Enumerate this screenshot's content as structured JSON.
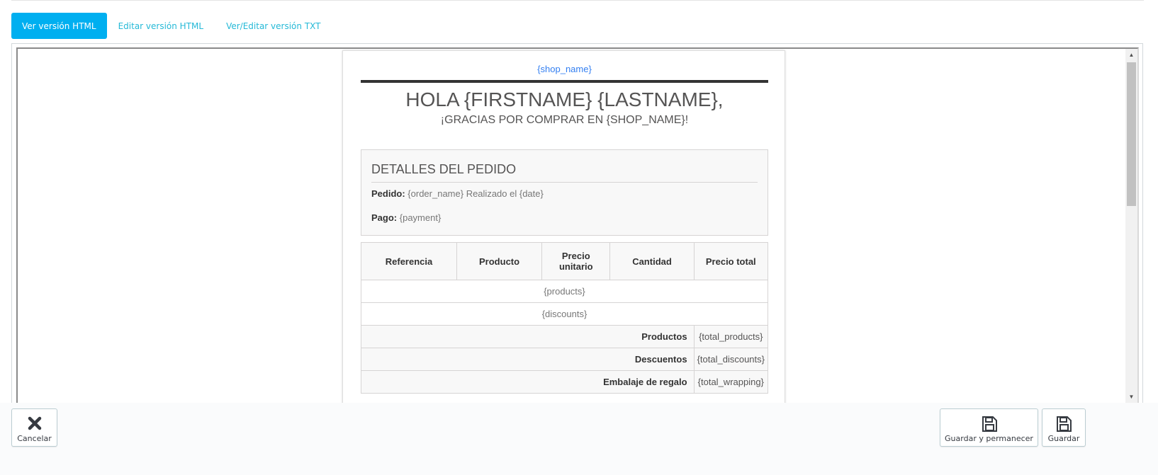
{
  "tabs": [
    {
      "label": "Ver versión HTML",
      "active": true
    },
    {
      "label": "Editar versión HTML",
      "active": false
    },
    {
      "label": "Ver/Editar versión TXT",
      "active": false
    }
  ],
  "email": {
    "shop_link": "{shop_name}",
    "greeting": "HOLA {FIRSTNAME} {LASTNAME},",
    "thanks": "¡GRACIAS POR COMPRAR EN {SHOP_NAME}!",
    "details": {
      "title": "DETALLES DEL PEDIDO",
      "order_label": "Pedido:",
      "order_value": "{order_name} Realizado el {date}",
      "payment_label": "Pago:",
      "payment_value": "{payment}"
    },
    "table": {
      "headers": [
        "Referencia",
        "Producto",
        "Precio unitario",
        "Cantidad",
        "Precio total"
      ],
      "products": "{products}",
      "discounts": "{discounts}",
      "totals": [
        {
          "label": "Productos",
          "value": "{total_products}"
        },
        {
          "label": "Descuentos",
          "value": "{total_discounts}"
        },
        {
          "label": "Embalaje de regalo",
          "value": "{total_wrapping}"
        }
      ]
    }
  },
  "footer": {
    "cancel_label": "Cancelar",
    "save_stay_label": "Guardar y permanecer",
    "save_label": "Guardar"
  },
  "colors": {
    "accent": "#00aff0",
    "tab_link": "#25b9d7",
    "shop_link": "#337ff1"
  },
  "icons": {
    "cancel": "close-icon",
    "save_stay": "save-icon",
    "save": "save-icon"
  }
}
